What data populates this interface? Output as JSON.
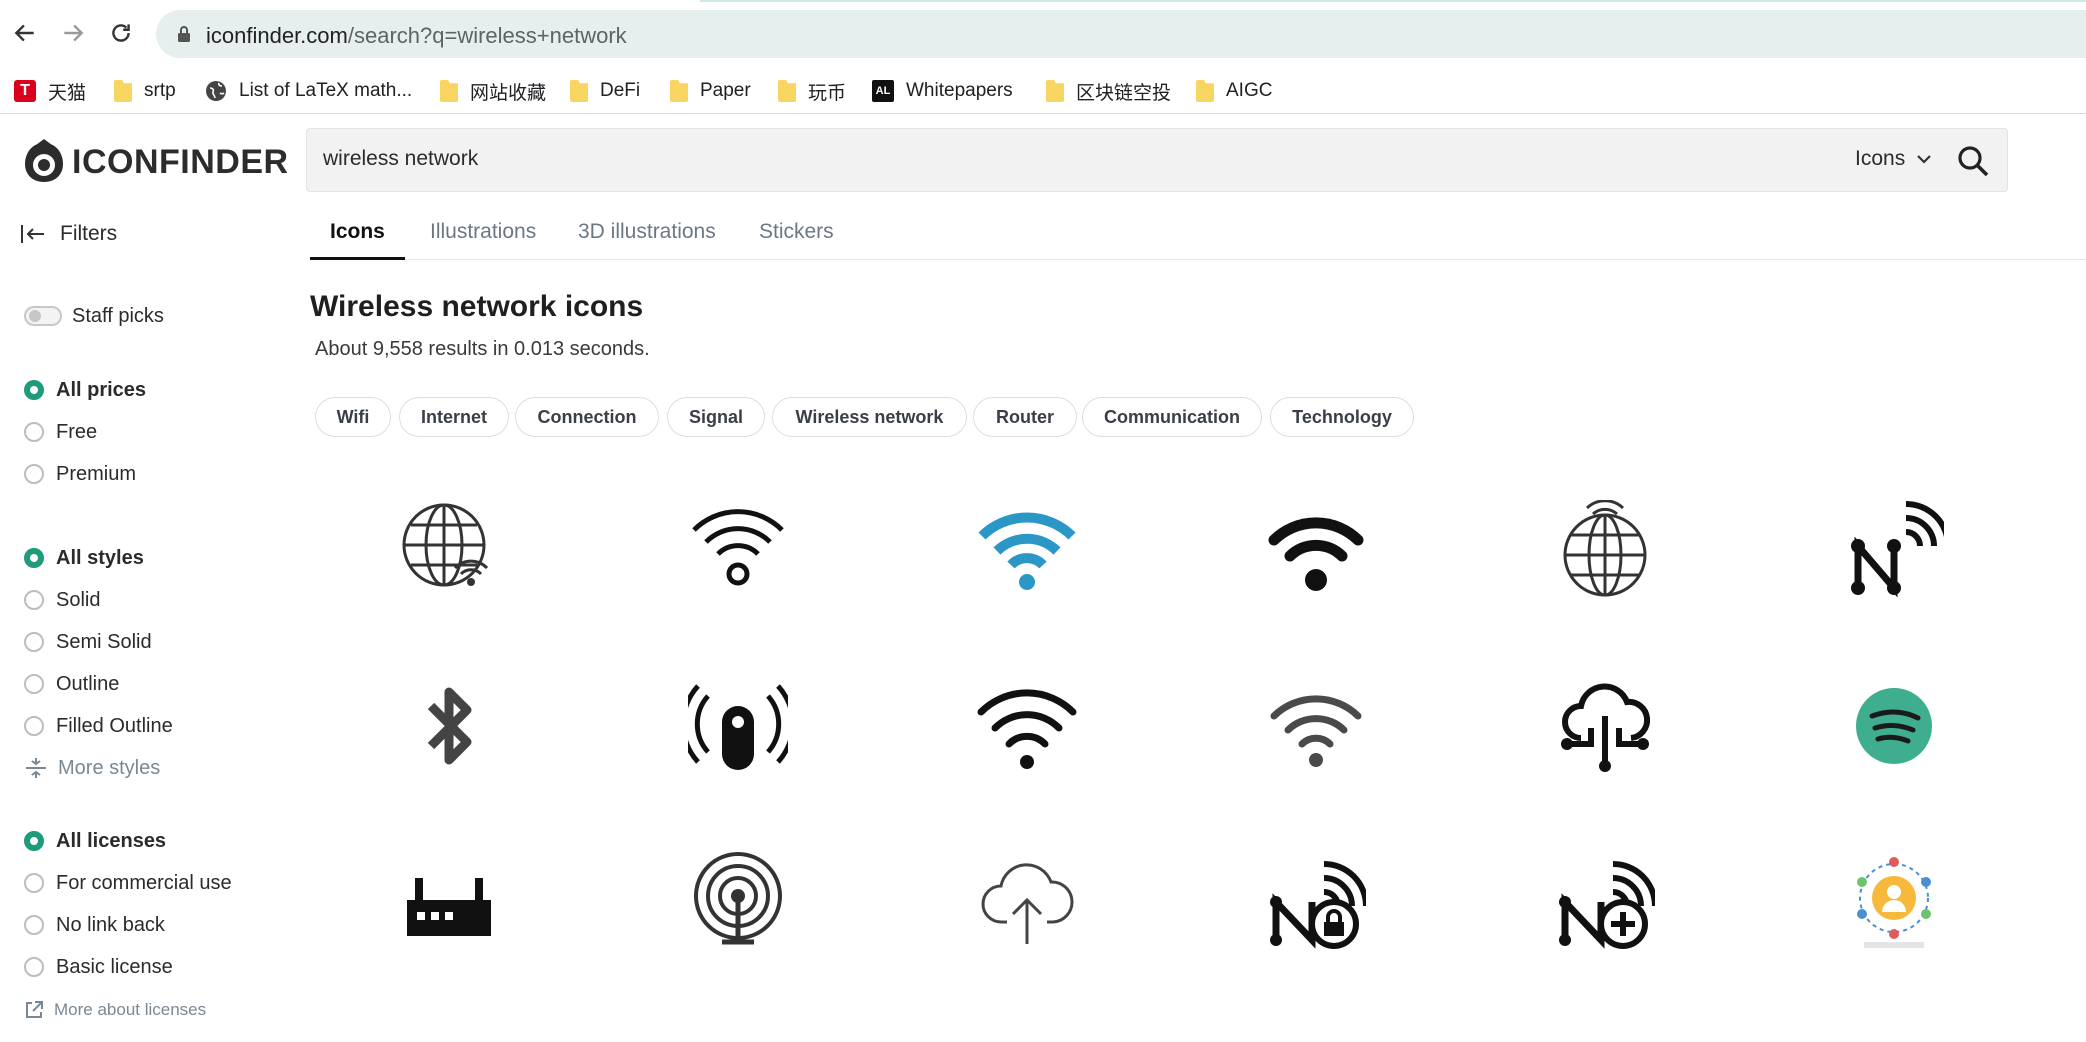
{
  "browser": {
    "url_domain": "iconfinder.com",
    "url_path": "/search?q=wireless+network"
  },
  "bookmarks": [
    {
      "label": "天猫",
      "icon": "tmall-icon"
    },
    {
      "label": "srtp",
      "icon": "folder-icon"
    },
    {
      "label": "List of LaTeX math...",
      "icon": "globe-icon"
    },
    {
      "label": "网站收藏",
      "icon": "folder-icon"
    },
    {
      "label": "DeFi",
      "icon": "folder-icon"
    },
    {
      "label": "Paper",
      "icon": "folder-icon"
    },
    {
      "label": "玩币",
      "icon": "folder-icon"
    },
    {
      "label": "Whitepapers",
      "icon": "al-icon"
    },
    {
      "label": "区块链空投",
      "icon": "folder-icon"
    },
    {
      "label": "AIGC",
      "icon": "folder-icon"
    }
  ],
  "header": {
    "logo_text": "ICONFINDER",
    "search_value": "wireless network",
    "type_select": "Icons"
  },
  "tabs": [
    "Icons",
    "Illustrations",
    "3D illustrations",
    "Stickers"
  ],
  "filters_label": "Filters",
  "sidebar": {
    "staff_picks": "Staff picks",
    "prices": [
      "All prices",
      "Free",
      "Premium"
    ],
    "styles": [
      "All styles",
      "Solid",
      "Semi Solid",
      "Outline",
      "Filled Outline"
    ],
    "more_styles": "More styles",
    "licenses": [
      "All licenses",
      "For commercial use",
      "No link back",
      "Basic license"
    ],
    "more_licenses": "More about licenses"
  },
  "main": {
    "title": "Wireless network icons",
    "results": "About 9,558 results in 0.013 seconds.",
    "chips": [
      "Wifi",
      "Internet",
      "Connection",
      "Signal",
      "Wireless network",
      "Router",
      "Communication",
      "Technology"
    ]
  },
  "icons": [
    [
      "globe-wifi-icon",
      "wifi-signal-outline-icon",
      "wifi-blue-icon",
      "wifi-solid-icon",
      "globe-signal-icon",
      "network-n-signal-icon"
    ],
    [
      "bluetooth-icon",
      "wireless-sensor-icon",
      "wifi-bold-icon",
      "wifi-gray-icon",
      "cloud-network-icon",
      "spotify-icon"
    ],
    [
      "router-icon",
      "antenna-broadcast-icon",
      "cloud-upload-icon",
      "network-lock-icon",
      "network-add-icon",
      "user-network-icon"
    ]
  ],
  "colors": {
    "accent_green": "#1e9b7a",
    "wifi_blue": "#2a97c7",
    "spotify_green": "#3fae8e"
  }
}
